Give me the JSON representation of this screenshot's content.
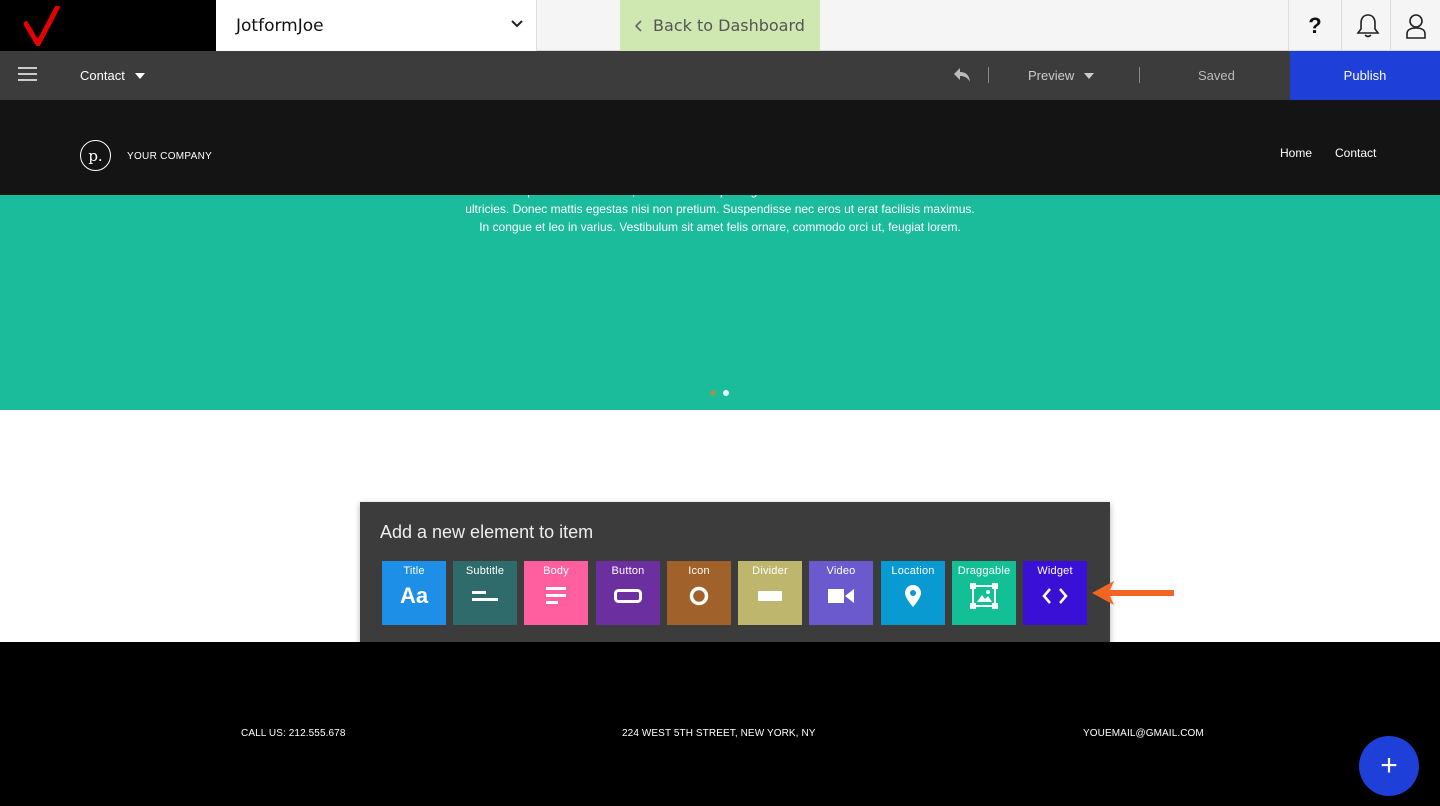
{
  "topbar": {
    "account_name": "JotformJoe",
    "back_label": "Back to Dashboard",
    "help_glyph": "?"
  },
  "toolbar": {
    "page_label": "Contact",
    "preview_label": "Preview",
    "status_label": "Saved",
    "publish_label": "Publish"
  },
  "site": {
    "brand_mark": "p.",
    "brand_name": "YOUR COMPANY",
    "nav": [
      "Home",
      "Contact"
    ],
    "hero_text": "Lorem ipsum dolor sit amet, consectetur adipiscing elit. Sed malesuada faucibus ex nec ultricies. Donec mattis egestas nisi non pretium. Suspendisse nec eros ut erat facilisis maximus. In congue et leo in varius. Vestibulum sit amet felis ornare, commodo orci ut, feugiat lorem.",
    "slider_dots": 2
  },
  "panel": {
    "title": "Add a new element to item",
    "tiles": [
      {
        "label": "Title",
        "color": "#1e8fe6",
        "icon": "text-aa-icon",
        "glyph": "Aa"
      },
      {
        "label": "Subtitle",
        "color": "#2f6b6b",
        "icon": "subtitle-lines-icon"
      },
      {
        "label": "Body",
        "color": "#ff5f9e",
        "icon": "body-lines-icon"
      },
      {
        "label": "Button",
        "color": "#6c2fa0",
        "icon": "button-shape-icon"
      },
      {
        "label": "Icon",
        "color": "#a0622a",
        "icon": "circle-icon"
      },
      {
        "label": "Divider",
        "color": "#bdb66c",
        "icon": "divider-bar-icon"
      },
      {
        "label": "Video",
        "color": "#6a5acd",
        "icon": "video-camera-icon"
      },
      {
        "label": "Location",
        "color": "#0a9ad2",
        "icon": "map-pin-icon"
      },
      {
        "label": "Draggable",
        "color": "#13bf95",
        "icon": "image-frame-icon"
      },
      {
        "label": "Widget",
        "color": "#3a10d6",
        "icon": "code-brackets-icon"
      }
    ]
  },
  "footer": {
    "phone": "CALL US: 212.555.678",
    "address": "224 WEST 5TH STREET, NEW YORK, NY",
    "email": "YOUEMAIL@GMAIL.COM"
  },
  "fab": {
    "glyph": "+"
  },
  "colors": {
    "brand_red": "#e60000",
    "publish_blue": "#1e40d9",
    "hero_teal": "#1abc9c",
    "back_green": "#cfe8b1",
    "pointer_orange": "#f26522"
  }
}
